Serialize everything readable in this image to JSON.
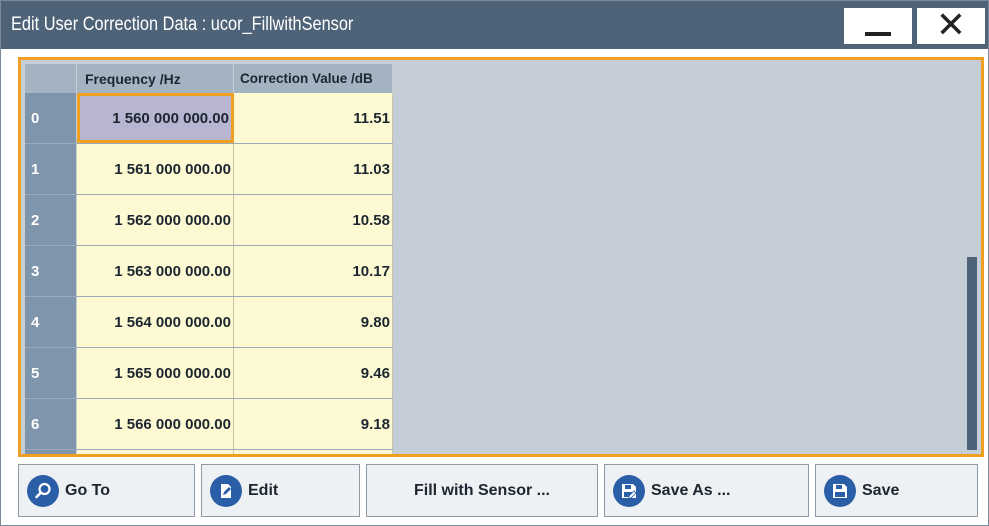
{
  "window": {
    "title": "Edit User Correction Data : ucor_FillwithSensor",
    "minimize_icon": "minimize-icon",
    "close_icon": "close-icon"
  },
  "table": {
    "headers": {
      "frequency": "Frequency /Hz",
      "correction": "Correction Value /dB"
    },
    "rows": [
      {
        "index": "0",
        "frequency": "1 560 000 000.00",
        "correction": "11.51"
      },
      {
        "index": "1",
        "frequency": "1 561 000 000.00",
        "correction": "11.03"
      },
      {
        "index": "2",
        "frequency": "1 562 000 000.00",
        "correction": "10.58"
      },
      {
        "index": "3",
        "frequency": "1 563 000 000.00",
        "correction": "10.17"
      },
      {
        "index": "4",
        "frequency": "1 564 000 000.00",
        "correction": "9.80"
      },
      {
        "index": "5",
        "frequency": "1 565 000 000.00",
        "correction": "9.46"
      },
      {
        "index": "6",
        "frequency": "1 566 000 000.00",
        "correction": "9.18"
      }
    ],
    "selected_row": 0,
    "scroll": {
      "thumb_start": 0.5,
      "thumb_end": 1.0
    }
  },
  "buttons": {
    "goto": {
      "label": "Go To",
      "icon": "search-icon"
    },
    "edit": {
      "label": "Edit",
      "icon": "edit-document-icon"
    },
    "fill": {
      "label": "Fill with Sensor ..."
    },
    "save_as": {
      "label": "Save As ...",
      "icon": "save-as-icon"
    },
    "save": {
      "label": "Save",
      "icon": "save-icon"
    }
  },
  "colors": {
    "titlebar": "#4e6378",
    "focus": "#f0a020",
    "cell": "#fdfad3",
    "selected_cell": "#b7b5d0",
    "button_icon": "#2a5fa8"
  }
}
